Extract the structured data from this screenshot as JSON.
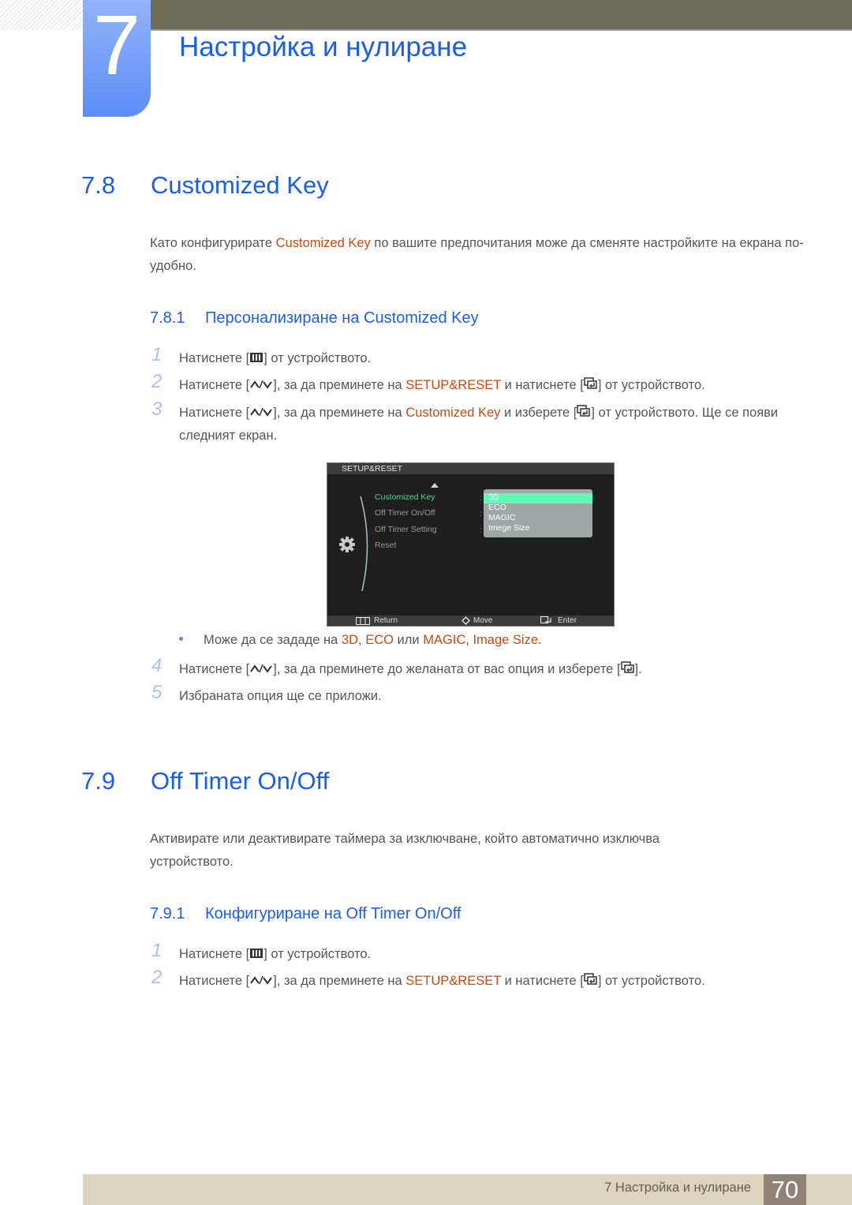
{
  "header": {
    "chapter_number": "7",
    "chapter_title": "Настройка и нулиране"
  },
  "section_78": {
    "number": "7.8",
    "title": "Customized Key",
    "intro": {
      "pre": "Като конфигурирате ",
      "highlight": "Customized Key",
      "post": " по вашите предпочитания може да сменяте настройките на екрана по-удобно."
    },
    "subsection": {
      "number": "7.8.1",
      "title": "Персонализиране на Customized Key"
    },
    "steps": [
      {
        "n": "1",
        "a": "Натиснете [",
        "b": "] от устройството.",
        "key": "menu-key"
      },
      {
        "n": "2",
        "a": "Натиснете [",
        "b": "], за да преминете на ",
        "hl": "SETUP&RESET",
        "c": " и натиснете [",
        "d": "] от устройството."
      },
      {
        "n": "3",
        "a": "Натиснете [",
        "b": "], за да преминете на ",
        "hl": "Customized Key",
        "c": " и изберете [",
        "d": "] от устройството. Ще се появи следният екран."
      },
      {
        "n": "4",
        "a": "Натиснете [",
        "b": "], за да преминете до желаната от вас опция и изберете [",
        "d": "]."
      },
      {
        "n": "5",
        "a": "Избраната опция ще се приложи."
      }
    ],
    "note": {
      "pre": "Може да се зададе на ",
      "opt1": "3D",
      "sep1": ", ",
      "opt2": "ECO",
      "sep2": " или ",
      "opt3": "MAGIC",
      "sep3": ", ",
      "opt4": "Image Size",
      "end": "."
    }
  },
  "osd": {
    "title": "SETUP&RESET",
    "menu_items": [
      "Customized Key",
      "Off Timer On/Off",
      "Off Timer Setting",
      "Reset"
    ],
    "selected_item": "Customized Key",
    "dropdown_options": [
      "3D",
      "ECO",
      "MAGIC",
      "Imege Size"
    ],
    "selected_option": "3D",
    "footer": {
      "return": "Return",
      "move": "Move",
      "enter": "Enter"
    }
  },
  "section_79": {
    "number": "7.9",
    "title": "Off Timer On/Off",
    "intro": "Активирате или деактивирате таймера за изключване, който автоматично изключва устройството.",
    "subsection": {
      "number": "7.9.1",
      "title": "Конфигуриране на Off Timer On/Off"
    },
    "steps": [
      {
        "n": "1",
        "a": "Натиснете [",
        "b": "] от устройството."
      },
      {
        "n": "2",
        "a": "Натиснете [",
        "b": "], за да преминете на ",
        "hl": "SETUP&RESET",
        "c": " и натиснете [",
        "d": "] от устройството."
      }
    ]
  },
  "footer": {
    "chapter_label": "7 Настройка и нулиране",
    "page_number": "70"
  }
}
